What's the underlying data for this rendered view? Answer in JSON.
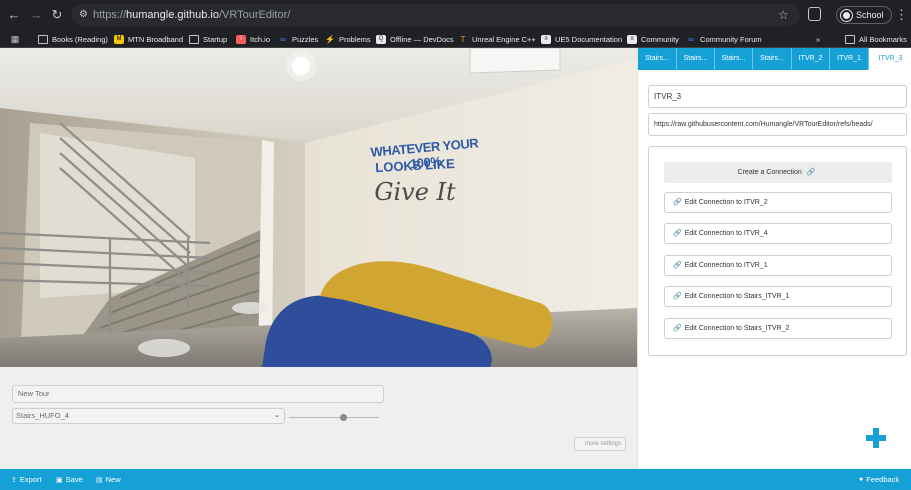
{
  "browser": {
    "url_scheme": "https://",
    "url_host": "humangle.github.io",
    "url_path": "/VRTourEditor/",
    "profile_label": "School",
    "bookmarks": [
      {
        "label": "Books (Reading)",
        "icon": "folder-icon"
      },
      {
        "label": "MTN Broadband",
        "icon": "mtn-icon"
      },
      {
        "label": "Startup",
        "icon": "folder-icon"
      },
      {
        "label": "Itch.io",
        "icon": "itchio-icon"
      },
      {
        "label": "Puzzles",
        "icon": "puzzles-icon"
      },
      {
        "label": "Problems",
        "icon": "problems-icon"
      },
      {
        "label": "Offline — DevDocs",
        "icon": "devdocs-icon"
      },
      {
        "label": "Unreal Engine C++",
        "icon": "unreal-icon"
      },
      {
        "label": "UE5 Documentation",
        "icon": "ue5-docs-icon"
      },
      {
        "label": "Community",
        "icon": "community-icon"
      },
      {
        "label": "Community Forum",
        "icon": "forum-icon"
      }
    ],
    "overflow": "»",
    "all_bookmarks": "All Bookmarks"
  },
  "viewer": {
    "wall_text_1": "WHATEVER YOUR 100%",
    "wall_text_2": "LOOKS LIKE",
    "wall_text_3": "Give It"
  },
  "settings": {
    "tour_name": "New Tour",
    "scene_selected": "Stairs_HUFO_4",
    "zoom_level": 0.6,
    "more_settings": "more settings"
  },
  "panel": {
    "tabs": [
      "Stairs...",
      "Stairs...",
      "Stairs...",
      "Stairs...",
      "ITVR_2",
      "ITVR_1",
      "ITVR_3"
    ],
    "active_tab": 6,
    "scene_name": "ITVR_3",
    "image_url": "https://raw.githubusercontent.com/Humangle/VRTourEditor/refs/heads/",
    "create_connection": "Create a Connection",
    "connections": [
      "Edit Connection to ITVR_2",
      "Edit Connection to ITVR_4",
      "Edit Connection to ITVR_1",
      "Edit Connection to Stairs_ITVR_1",
      "Edit Connection to Stairs_ITVR_2"
    ]
  },
  "footer": {
    "export": "Export",
    "save": "Save",
    "new": "New",
    "feedback": "Feedback"
  },
  "colors": {
    "accent": "#15a1d6",
    "browser_bg": "#202124"
  }
}
